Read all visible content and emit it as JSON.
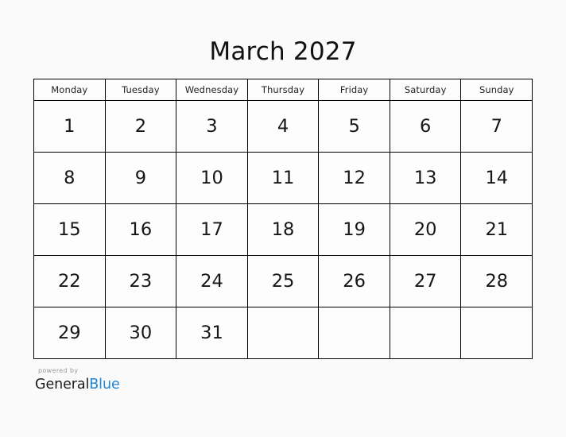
{
  "title": "March 2027",
  "calendar": {
    "month_name": "March",
    "year": "2027",
    "weekday_headers": [
      "Monday",
      "Tuesday",
      "Wednesday",
      "Thursday",
      "Friday",
      "Saturday",
      "Sunday"
    ],
    "weeks": [
      [
        "1",
        "2",
        "3",
        "4",
        "5",
        "6",
        "7"
      ],
      [
        "8",
        "9",
        "10",
        "11",
        "12",
        "13",
        "14"
      ],
      [
        "15",
        "16",
        "17",
        "18",
        "19",
        "20",
        "21"
      ],
      [
        "22",
        "23",
        "24",
        "25",
        "26",
        "27",
        "28"
      ],
      [
        "29",
        "30",
        "31",
        "",
        "",
        "",
        ""
      ]
    ]
  },
  "footer": {
    "powered_by_label": "powered by",
    "brand_primary": "General",
    "brand_accent": "Blue"
  },
  "colors": {
    "page_background": "#fafafa",
    "cell_background": "#fdfdfd",
    "grid_line": "#000000",
    "title_text": "#111111",
    "day_text": "#161616",
    "header_text": "#222222",
    "powered_by_text": "#9a9a9a",
    "brand_primary": "#1a1a1a",
    "brand_accent": "#2185d0"
  }
}
